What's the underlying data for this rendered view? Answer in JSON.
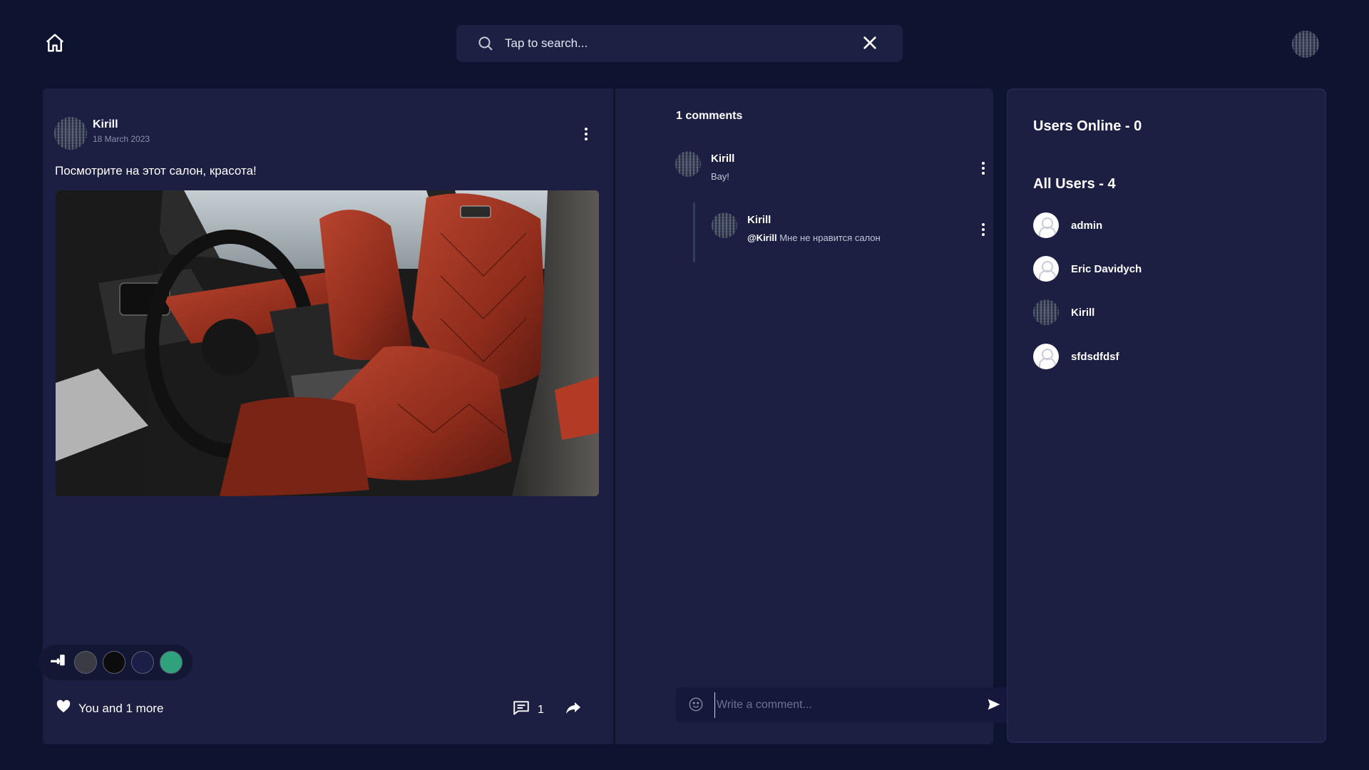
{
  "search": {
    "placeholder": "Tap to search..."
  },
  "post": {
    "author": "Kirill",
    "date": "18 March 2023",
    "text": "Посмотрите на этот салон, красота!",
    "likes_label": "You and 1 more",
    "comment_count": "1",
    "theme_colors": [
      "#3a3b43",
      "#0c0c0c",
      "#1b1e46",
      "#2fa27c"
    ]
  },
  "comments": {
    "title": "1 comments",
    "items": [
      {
        "author": "Kirill",
        "text": "Вау!"
      },
      {
        "author": "Kirill",
        "mention": "@Kirill",
        "text": " Мне не нравится салон"
      }
    ],
    "input_placeholder": "Write a comment..."
  },
  "users": {
    "online_title": "Users Online - 0",
    "all_title": "All Users - 4",
    "list": [
      {
        "name": "admin",
        "avatar": "default"
      },
      {
        "name": "Eric Davidych",
        "avatar": "default"
      },
      {
        "name": "Kirill",
        "avatar": "pixel"
      },
      {
        "name": "sfdsdfdsf",
        "avatar": "default"
      }
    ]
  }
}
